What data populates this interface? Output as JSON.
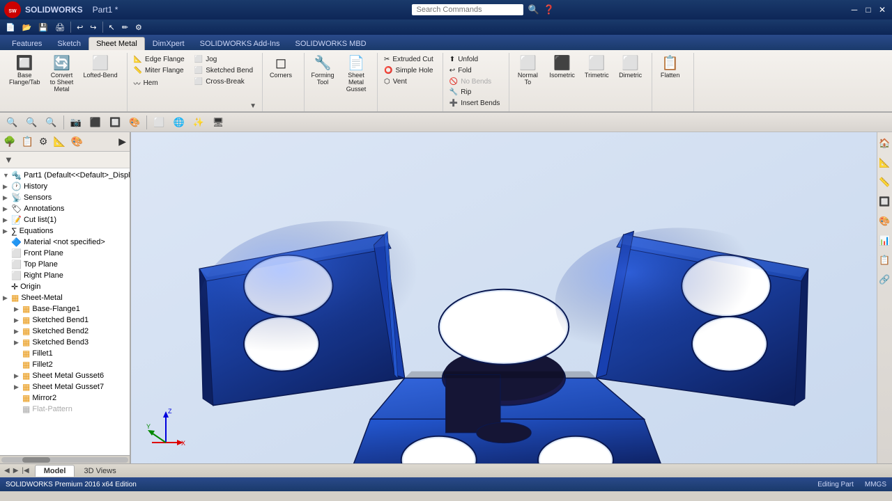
{
  "app": {
    "title": "Part1 * - SOLIDWORKS Premium 2016 x64 Edition",
    "logo_text": "SW",
    "window_title": "Part1 *"
  },
  "titlebar": {
    "search_placeholder": "Search Commands",
    "controls": [
      "─",
      "□",
      "✕"
    ]
  },
  "quick_toolbar": {
    "buttons": [
      "New",
      "Open",
      "Save",
      "Print",
      "Undo",
      "Redo",
      "Select",
      "3D Sketch",
      "Options"
    ]
  },
  "ribbon": {
    "tabs": [
      "Features",
      "Sketch",
      "Sheet Metal",
      "DimXpert",
      "SOLIDWORKS Add-Ins",
      "SOLIDWORKS MBD"
    ],
    "active_tab": "Sheet Metal",
    "groups": {
      "main_tools": [
        {
          "icon": "🔲",
          "label": "Base\nFlange/Tab"
        },
        {
          "icon": "🔄",
          "label": "Convert\nto Sheet\nMetal"
        },
        {
          "icon": "⬜",
          "label": "Lofted-Bend"
        }
      ],
      "edge_tools": [
        {
          "icon": "📐",
          "label": "Edge Flange"
        },
        {
          "icon": "〰",
          "label": "Miter Flange"
        },
        {
          "icon": "⬜",
          "label": "Hem"
        },
        {
          "icon": "⬜",
          "label": "Jog"
        },
        {
          "icon": "⬜",
          "label": "Sketched Bend"
        },
        {
          "icon": "⬜",
          "label": "Cross-Break"
        }
      ],
      "corners": [
        {
          "icon": "◻",
          "label": "Corners"
        }
      ],
      "forming": [
        {
          "icon": "🔧",
          "label": "Forming\nTool"
        },
        {
          "icon": "📄",
          "label": "Sheet\nMetal\nGusset"
        }
      ],
      "cuts": [
        {
          "icon": "✂",
          "label": "Extruded Cut"
        },
        {
          "icon": "⭕",
          "label": "Simple Hole"
        },
        {
          "icon": "⬡",
          "label": "Vent"
        }
      ],
      "bends": [
        {
          "icon": "⬆",
          "label": "Unfold"
        },
        {
          "icon": "↩",
          "label": "Fold"
        },
        {
          "icon": "🚫",
          "label": "No\nBends"
        },
        {
          "icon": "🔧",
          "label": "Rip"
        },
        {
          "icon": "➕",
          "label": "Insert\nBends"
        }
      ],
      "view_tools": [
        {
          "icon": "⬜",
          "label": "Normal\nTo"
        },
        {
          "icon": "⬜",
          "label": "Isometric"
        },
        {
          "icon": "⬜",
          "label": "Trimetric"
        },
        {
          "icon": "⬜",
          "label": "Dimetric"
        }
      ],
      "flatten": [
        {
          "icon": "📋",
          "label": "Flatten"
        }
      ]
    }
  },
  "view_toolbar": {
    "buttons": [
      "🔍",
      "🔍+",
      "🔍-",
      "📸",
      "🔲",
      "⬛",
      "🔲",
      "🔲",
      "🌐",
      "🎨",
      "✨",
      "🖥"
    ]
  },
  "feature_tree": {
    "filter_label": "Filter",
    "root_item": "Part1 (Default<<Default>_Displ...",
    "items": [
      {
        "id": "history",
        "label": "History",
        "icon": "📋",
        "expandable": true,
        "indent": 0
      },
      {
        "id": "sensors",
        "label": "Sensors",
        "icon": "📡",
        "expandable": true,
        "indent": 0
      },
      {
        "id": "annotations",
        "label": "Annotations",
        "icon": "🏷",
        "expandable": true,
        "indent": 0
      },
      {
        "id": "cutlist",
        "label": "Cut list(1)",
        "icon": "📝",
        "expandable": true,
        "indent": 0
      },
      {
        "id": "equations",
        "label": "Equations",
        "icon": "∑",
        "expandable": true,
        "indent": 0
      },
      {
        "id": "material",
        "label": "Material <not specified>",
        "icon": "🔷",
        "expandable": false,
        "indent": 0
      },
      {
        "id": "frontplane",
        "label": "Front Plane",
        "icon": "⬜",
        "expandable": false,
        "indent": 0
      },
      {
        "id": "topplane",
        "label": "Top Plane",
        "icon": "⬜",
        "expandable": false,
        "indent": 0
      },
      {
        "id": "rightplane",
        "label": "Right Plane",
        "icon": "⬜",
        "expandable": false,
        "indent": 0
      },
      {
        "id": "origin",
        "label": "Origin",
        "icon": "✛",
        "expandable": false,
        "indent": 0
      },
      {
        "id": "sheetmetal",
        "label": "Sheet-Metal",
        "icon": "🔶",
        "expandable": true,
        "indent": 0
      },
      {
        "id": "baseflange1",
        "label": "Base-Flange1",
        "icon": "🔶",
        "expandable": true,
        "indent": 1
      },
      {
        "id": "sketchedbend1",
        "label": "Sketched Bend1",
        "icon": "🔶",
        "expandable": true,
        "indent": 1
      },
      {
        "id": "sketchedbend2",
        "label": "Sketched Bend2",
        "icon": "🔶",
        "expandable": true,
        "indent": 1
      },
      {
        "id": "sketchedbend3",
        "label": "Sketched Bend3",
        "icon": "🔶",
        "expandable": true,
        "indent": 1
      },
      {
        "id": "fillet1",
        "label": "Fillet1",
        "icon": "🔶",
        "expandable": false,
        "indent": 1
      },
      {
        "id": "fillet2",
        "label": "Fillet2",
        "icon": "🔶",
        "expandable": false,
        "indent": 1
      },
      {
        "id": "sheetmetalgusset6",
        "label": "Sheet Metal Gusset6",
        "icon": "🔶",
        "expandable": true,
        "indent": 1
      },
      {
        "id": "sheetmetalgusset7",
        "label": "Sheet Metal Gusset7",
        "icon": "🔶",
        "expandable": true,
        "indent": 1
      },
      {
        "id": "mirror2",
        "label": "Mirror2",
        "icon": "🔶",
        "expandable": false,
        "indent": 1
      },
      {
        "id": "flatpattern",
        "label": "Flat-Pattern",
        "icon": "🔶",
        "expandable": false,
        "indent": 1,
        "grayed": true
      }
    ]
  },
  "bottom_tabs": {
    "tabs": [
      "Model",
      "3D Views"
    ],
    "active_tab": "Model"
  },
  "statusbar": {
    "left": "SOLIDWORKS Premium 2016 x64 Edition",
    "right_items": [
      "Editing Part",
      "MMGS"
    ]
  },
  "viewport": {
    "background_color_top": "#e8eef8",
    "background_color_bottom": "#dde4f0",
    "part_color": "#1a3f9f"
  },
  "right_panel_buttons": [
    "🏠",
    "📐",
    "📏",
    "🔲",
    "🎨",
    "📊",
    "📋",
    "🔗"
  ],
  "axes": {
    "x_label": "X",
    "y_label": "Y",
    "z_label": "Z"
  }
}
